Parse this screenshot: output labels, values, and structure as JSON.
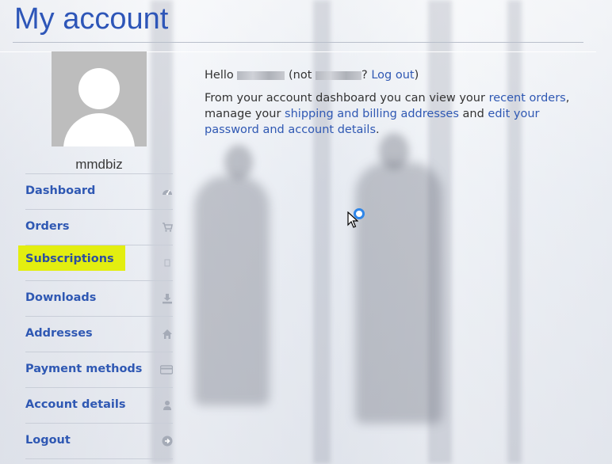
{
  "page": {
    "title": "My account"
  },
  "profile": {
    "username": "mmdbiz"
  },
  "nav": {
    "items": [
      {
        "label": "Dashboard",
        "icon": "dashboard-icon"
      },
      {
        "label": "Orders",
        "icon": "cart-icon"
      },
      {
        "label": "Subscriptions",
        "icon": "subscriptions-icon",
        "highlighted": true
      },
      {
        "label": "Downloads",
        "icon": "download-icon"
      },
      {
        "label": "Addresses",
        "icon": "home-icon"
      },
      {
        "label": "Payment methods",
        "icon": "credit-card-icon"
      },
      {
        "label": "Account details",
        "icon": "user-icon"
      },
      {
        "label": "Logout",
        "icon": "arrow-right-circle-icon"
      }
    ]
  },
  "content": {
    "hello": "Hello",
    "not_prefix": "(not",
    "not_suffix": "?",
    "logout_link": "Log out",
    "close_paren": ")",
    "intro_1": "From your account dashboard you can view your",
    "recent_orders_link": "recent orders",
    "intro_2": ", manage your",
    "addresses_link": "shipping and billing addresses",
    "intro_3": "and",
    "account_link": "edit your password and account details",
    "intro_4": "."
  },
  "colors": {
    "accent": "#2f58b3",
    "highlight": "#e3ee10",
    "title": "#2e56b8"
  }
}
